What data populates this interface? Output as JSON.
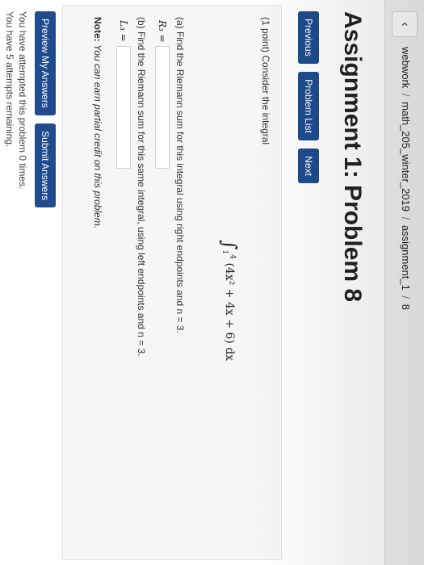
{
  "breadcrumb": {
    "items": [
      "webwork",
      "math_205_winter_2019",
      "assignment_1",
      "8"
    ],
    "separator": "/"
  },
  "page_title": "Assignment 1: Problem 8",
  "nav": {
    "previous": "Previous",
    "problem_list": "Problem List",
    "next": "Next"
  },
  "problem": {
    "intro": "(1 point) Consider the integral",
    "integral": {
      "lower": "1",
      "upper": "4",
      "integrand": "(4x² + 4x + 6) dx"
    },
    "part_a": {
      "text": "(a) Find the Riemann sum for this integral using right endpoints and n = 3.",
      "label": "R₃ ="
    },
    "part_b": {
      "text": "(b) Find the Riemann sum for this same integral, using left endpoints and n = 3.",
      "label": "L₃ ="
    },
    "note_label": "Note:",
    "note_text": "You can earn partial credit on this problem."
  },
  "actions": {
    "preview": "Preview My Answers",
    "submit": "Submit Answers"
  },
  "status": {
    "attempted": "You have attempted this problem 0 times.",
    "remaining": "You have 5 attempts remaining."
  },
  "colors": {
    "button": "#1e4c8f",
    "panel": "#f6f6f6"
  },
  "icons": {
    "back": "chevron-left-icon",
    "taskbar": [
      "windows-icon",
      "word-icon",
      "taskbar-app-icon",
      "powerpoint-icon",
      "taskbar-app-icon",
      "settings-icon",
      "camera-icon",
      "chrome-icon"
    ]
  }
}
